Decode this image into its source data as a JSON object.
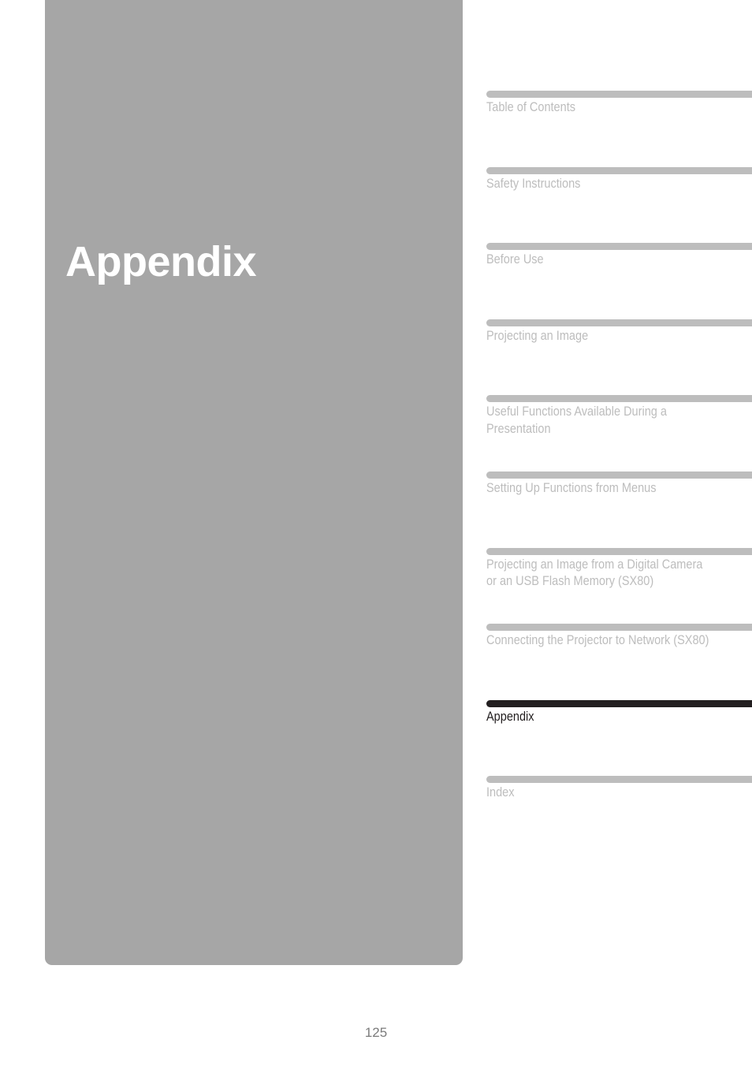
{
  "page": {
    "number": "125",
    "chapter_title": "Appendix",
    "panel_color": "#a6a6a6",
    "bar_color": "#bdbdbd",
    "bar_color_active": "#231f20",
    "label_color": "#bdbdbd",
    "label_color_active": "#231f20",
    "title_color": "#ffffff",
    "background_color": "#ffffff",
    "page_number_color": "#7b7b7b"
  },
  "chapter_index": {
    "items": [
      {
        "label": "Table of Contents",
        "current": false
      },
      {
        "label": "Safety Instructions",
        "current": false
      },
      {
        "label": "Before Use",
        "current": false
      },
      {
        "label": "Projecting an Image",
        "current": false
      },
      {
        "label": "Useful Functions Available During a Presentation",
        "current": false
      },
      {
        "label": "Setting Up Functions from Menus",
        "current": false
      },
      {
        "label": "Projecting an Image from a Digital Camera or an USB Flash Memory (SX80)",
        "current": false
      },
      {
        "label": "Connecting the Projector to Network (SX80)",
        "current": false
      },
      {
        "label": "Appendix",
        "current": true
      },
      {
        "label": "Index",
        "current": false
      }
    ]
  }
}
